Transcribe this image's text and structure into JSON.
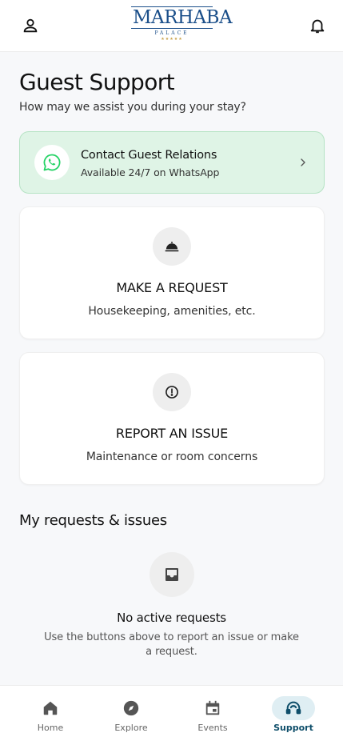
{
  "header": {
    "logo_main": "MARHABA",
    "logo_sub": "PALACE",
    "logo_stars": "★★★★★",
    "profile_icon": "person-icon",
    "notifications_icon": "bell-icon"
  },
  "page": {
    "title": "Guest Support",
    "subtitle": "How may we assist you during your stay?"
  },
  "whatsapp_card": {
    "title": "Contact Guest Relations",
    "subtitle": "Available 24/7 on WhatsApp",
    "icon": "whatsapp-icon",
    "accent": "#25d366"
  },
  "actions": [
    {
      "title": "MAKE A REQUEST",
      "subtitle": "Housekeeping, amenities, etc.",
      "icon": "room-service-icon"
    },
    {
      "title": "REPORT AN ISSUE",
      "subtitle": "Maintenance or room concerns",
      "icon": "alert-circle-icon"
    }
  ],
  "requests": {
    "section_title": "My requests & issues",
    "empty_title": "No active requests",
    "empty_subtitle": "Use the buttons above to report an issue or make a request.",
    "icon": "inbox-icon"
  },
  "bottom_nav": {
    "items": [
      {
        "label": "Home",
        "icon": "home-icon"
      },
      {
        "label": "Explore",
        "icon": "compass-icon"
      },
      {
        "label": "Events",
        "icon": "calendar-icon"
      },
      {
        "label": "Support",
        "icon": "support-headset-icon"
      }
    ],
    "active_color": "#0e4e6a"
  }
}
